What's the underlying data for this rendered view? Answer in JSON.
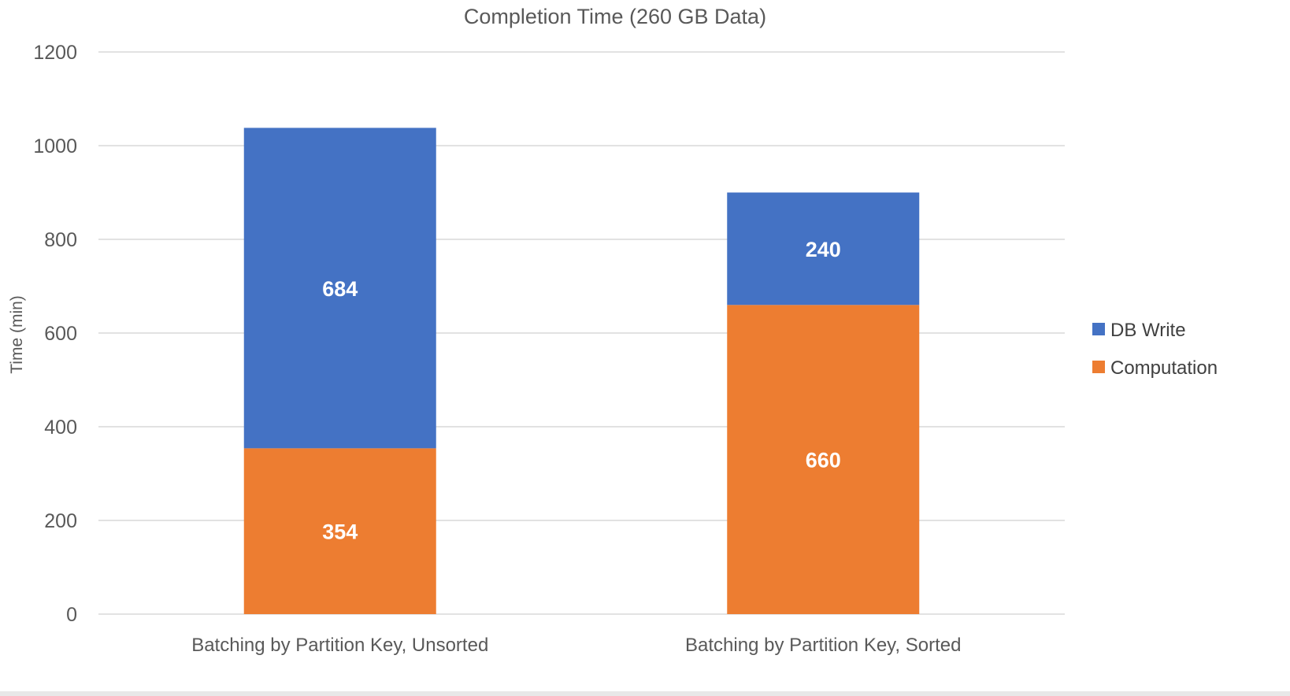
{
  "chart_data": {
    "type": "bar",
    "stacked": true,
    "title": "Completion Time (260 GB Data)",
    "xlabel": "",
    "ylabel": "Time (min)",
    "ylim": [
      0,
      1200
    ],
    "yticks": [
      0,
      200,
      400,
      600,
      800,
      1000,
      1200
    ],
    "grid": true,
    "legend_position": "right",
    "categories": [
      "Batching by Partition Key, Unsorted",
      "Batching by Partition Key, Sorted"
    ],
    "series": [
      {
        "name": "Computation",
        "color": "#ED7D31",
        "values": [
          354,
          660
        ]
      },
      {
        "name": "DB Write",
        "color": "#4472C4",
        "values": [
          684,
          240
        ]
      }
    ],
    "legend": [
      "DB Write",
      "Computation"
    ],
    "data_labels": true
  }
}
